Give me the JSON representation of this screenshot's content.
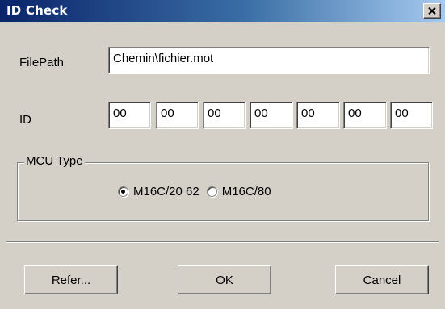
{
  "window": {
    "title": "ID Check",
    "close_glyph": "×"
  },
  "filepath": {
    "label": "FilePath",
    "value": "Chemin\\fichier.mot"
  },
  "id": {
    "label": "ID",
    "fields": [
      "00",
      "00",
      "00",
      "00",
      "00",
      "00",
      "00"
    ]
  },
  "mcu_type": {
    "group_title": "MCU Type",
    "options": [
      {
        "label": "M16C/20 62",
        "selected": true
      },
      {
        "label": "M16C/80",
        "selected": false
      }
    ]
  },
  "buttons": {
    "refer": "Refer...",
    "ok": "OK",
    "cancel": "Cancel"
  },
  "icons": {
    "close": "close-icon",
    "radio": "radio-icon"
  },
  "colors": {
    "titlebar_start": "#0a246a",
    "titlebar_end": "#a6caf0",
    "dialog_bg": "#d4d0c8"
  }
}
